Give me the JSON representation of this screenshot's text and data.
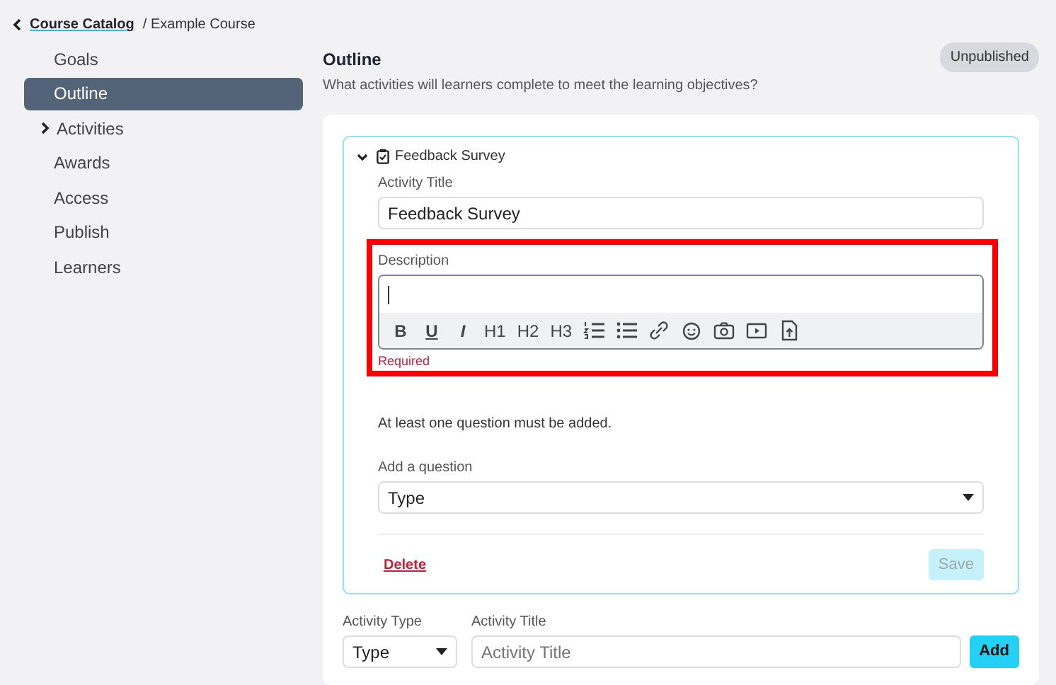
{
  "breadcrumb": {
    "link": "Course Catalog",
    "current": "/ Example Course"
  },
  "sidebar": {
    "items": [
      {
        "label": "Goals",
        "selected": false
      },
      {
        "label": "Outline",
        "selected": true
      },
      {
        "label": "Activities",
        "selected": false,
        "expandable": true
      },
      {
        "label": "Awards",
        "selected": false
      },
      {
        "label": "Access",
        "selected": false
      },
      {
        "label": "Publish",
        "selected": false
      },
      {
        "label": "Learners",
        "selected": false
      }
    ]
  },
  "header": {
    "title": "Outline",
    "subtitle": "What activities will learners complete to meet the learning objectives?",
    "status": "Unpublished"
  },
  "activity": {
    "title": "Feedback Survey",
    "expanded": true,
    "title_field": {
      "label": "Activity Title",
      "value": "Feedback Survey"
    },
    "description": {
      "label": "Description",
      "highlighted": true,
      "error": "Required",
      "toolbar": [
        {
          "kind": "bold",
          "label": "B"
        },
        {
          "kind": "underline",
          "label": "U"
        },
        {
          "kind": "italic",
          "label": "I"
        },
        {
          "kind": "text",
          "label": "H1"
        },
        {
          "kind": "text",
          "label": "H2"
        },
        {
          "kind": "text",
          "label": "H3"
        },
        {
          "kind": "ordered-list"
        },
        {
          "kind": "bullet-list"
        },
        {
          "kind": "link"
        },
        {
          "kind": "emoji"
        },
        {
          "kind": "image"
        },
        {
          "kind": "video"
        },
        {
          "kind": "file"
        }
      ]
    },
    "notice": "At least one question must be added.",
    "question": {
      "label": "Add a question",
      "value": "Type"
    },
    "delete": "Delete",
    "save": {
      "label": "Save",
      "disabled": true
    }
  },
  "new_activity": {
    "type_label": "Activity Type",
    "type_value": "Type",
    "title_label": "Activity Title",
    "title_placeholder": "Activity Title",
    "add": "Add"
  }
}
